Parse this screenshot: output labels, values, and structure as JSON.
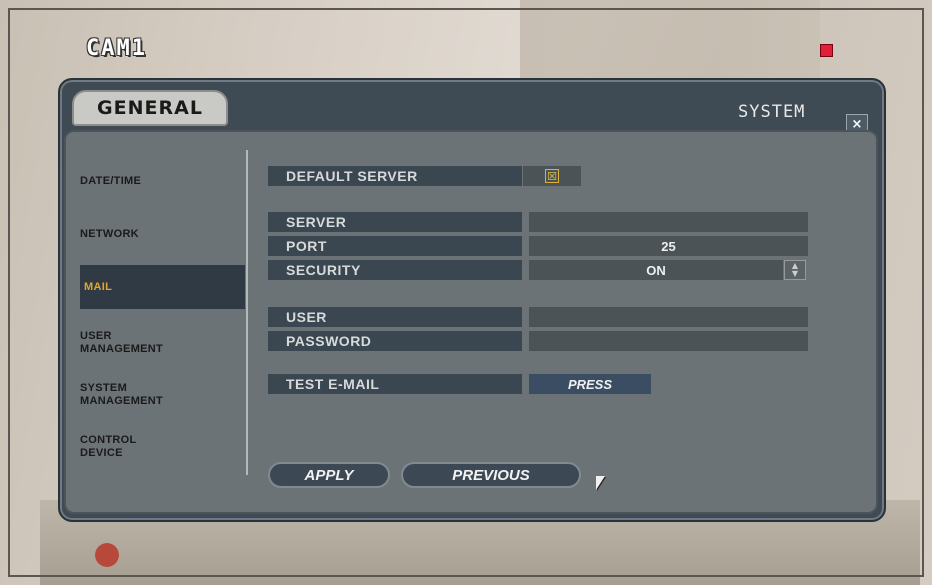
{
  "overlay": {
    "camera_label": "CAM1",
    "record_indicator_color": "#e0203a"
  },
  "header": {
    "tab_title": "GENERAL",
    "section_title": "SYSTEM",
    "close_icon": "×"
  },
  "sidebar": {
    "items": [
      {
        "label": "DATE/TIME",
        "active": false
      },
      {
        "label": "NETWORK",
        "active": false
      },
      {
        "label": "MAIL",
        "active": true
      },
      {
        "label": "USER\nMANAGEMENT",
        "active": false
      },
      {
        "label": "SYSTEM\nMANAGEMENT",
        "active": false
      },
      {
        "label": "CONTROL\nDEVICE",
        "active": false
      }
    ]
  },
  "mail": {
    "default_server": {
      "label": "DEFAULT SERVER",
      "checked": true,
      "check_glyph": "☒"
    },
    "server": {
      "label": "SERVER",
      "value": ""
    },
    "port": {
      "label": "PORT",
      "value": "25"
    },
    "security": {
      "label": "SECURITY",
      "value": "ON"
    },
    "user": {
      "label": "USER",
      "value": ""
    },
    "password": {
      "label": "PASSWORD",
      "value": ""
    },
    "test_email": {
      "label": "TEST E-MAIL",
      "button": "PRESS"
    }
  },
  "buttons": {
    "apply": "APPLY",
    "previous": "PREVIOUS"
  },
  "colors": {
    "accent_active": "#e3a626",
    "panel": "#3e4b55",
    "label_bg": "#3a4650",
    "value_bg": "#4c5356"
  }
}
